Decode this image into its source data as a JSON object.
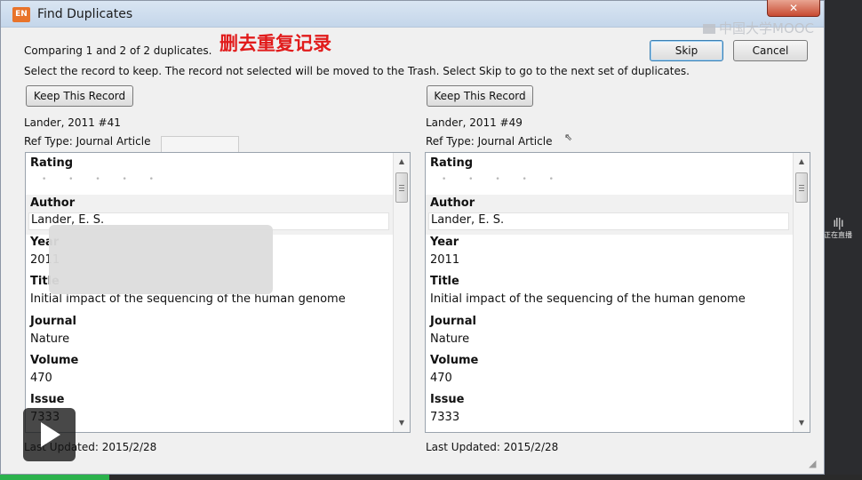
{
  "window": {
    "app_icon_text": "EN",
    "title": "Find Duplicates",
    "close_label": "✕"
  },
  "watermark": {
    "text": "中国大学MOOC"
  },
  "overlay_title": "删去重复记录",
  "header": {
    "comparing_text": "Comparing 1 and 2 of 2 duplicates.",
    "instructions": "Select the record to keep. The record not selected will be moved to the Trash. Select Skip to go to the next set of duplicates."
  },
  "buttons": {
    "skip": "Skip",
    "cancel": "Cancel"
  },
  "left": {
    "keep_label": "Keep This Record",
    "record_id": "Lander, 2011 #41",
    "ref_type": "Ref Type: Journal Article",
    "last_updated": "Last Updated: 2015/2/28",
    "fields": {
      "rating_label": "Rating",
      "rating_dots": "• • • • •",
      "author_label": "Author",
      "author_value": "Lander, E. S.",
      "year_label": "Year",
      "year_value": "2011",
      "title_label": "Title",
      "title_value": "Initial impact of the sequencing of the human genome",
      "journal_label": "Journal",
      "journal_value": "Nature",
      "volume_label": "Volume",
      "volume_value": "470",
      "issue_label": "Issue",
      "issue_value": "7333"
    }
  },
  "right": {
    "keep_label": "Keep This Record",
    "record_id": "Lander, 2011 #49",
    "ref_type": "Ref Type: Journal Article",
    "last_updated": "Last Updated: 2015/2/28",
    "fields": {
      "rating_label": "Rating",
      "rating_dots": "• • • • •",
      "author_label": "Author",
      "author_value": "Lander, E. S.",
      "year_label": "Year",
      "year_value": "2011",
      "title_label": "Title",
      "title_value": "Initial impact of the sequencing of the human genome",
      "journal_label": "Journal",
      "journal_value": "Nature",
      "volume_label": "Volume",
      "volume_value": "470",
      "issue_label": "Issue",
      "issue_value": "7333"
    }
  },
  "player": {
    "live_text": "正在直播",
    "live_bars": "ıl|ı",
    "progress_fraction": 0.127,
    "progress_color": "#2bb24c"
  }
}
